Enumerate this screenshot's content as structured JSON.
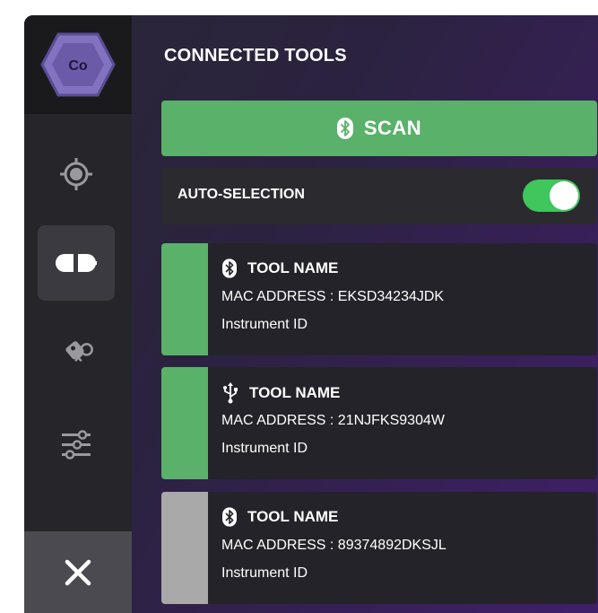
{
  "logo": {
    "text": "Co"
  },
  "sidebar": {
    "items": [
      {
        "icon": "crosshair-icon",
        "active": false
      },
      {
        "icon": "plug-connector-icon",
        "active": true
      },
      {
        "icon": "key-icon",
        "active": false
      },
      {
        "icon": "sliders-icon",
        "active": false
      }
    ],
    "close_icon": "close-icon"
  },
  "header": {
    "title": "CONNECTED TOOLS"
  },
  "scan": {
    "label": "SCAN",
    "icon": "bluetooth-icon"
  },
  "auto_selection": {
    "label": "AUTO-SELECTION",
    "enabled": true
  },
  "tools": [
    {
      "name": "TOOL NAME",
      "mac": "MAC ADDRESS : EKSD34234JDK",
      "instrument": "Instrument ID",
      "connection": "bluetooth-icon",
      "status_color": "#5ab169"
    },
    {
      "name": "TOOL NAME",
      "mac": "MAC ADDRESS : 21NJFKS9304W",
      "instrument": "Instrument ID",
      "connection": "usb-icon",
      "status_color": "#5ab169"
    },
    {
      "name": "TOOL NAME",
      "mac": "MAC ADDRESS : 89374892DKSJL",
      "instrument": "Instrument ID",
      "connection": "bluetooth-icon",
      "status_color": "#a9a9a9"
    }
  ],
  "colors": {
    "accent_green": "#5ab169",
    "toggle_on": "#3fc65c",
    "logo_purple": "#7b6bb8",
    "inactive_gray": "#a9a9a9"
  }
}
